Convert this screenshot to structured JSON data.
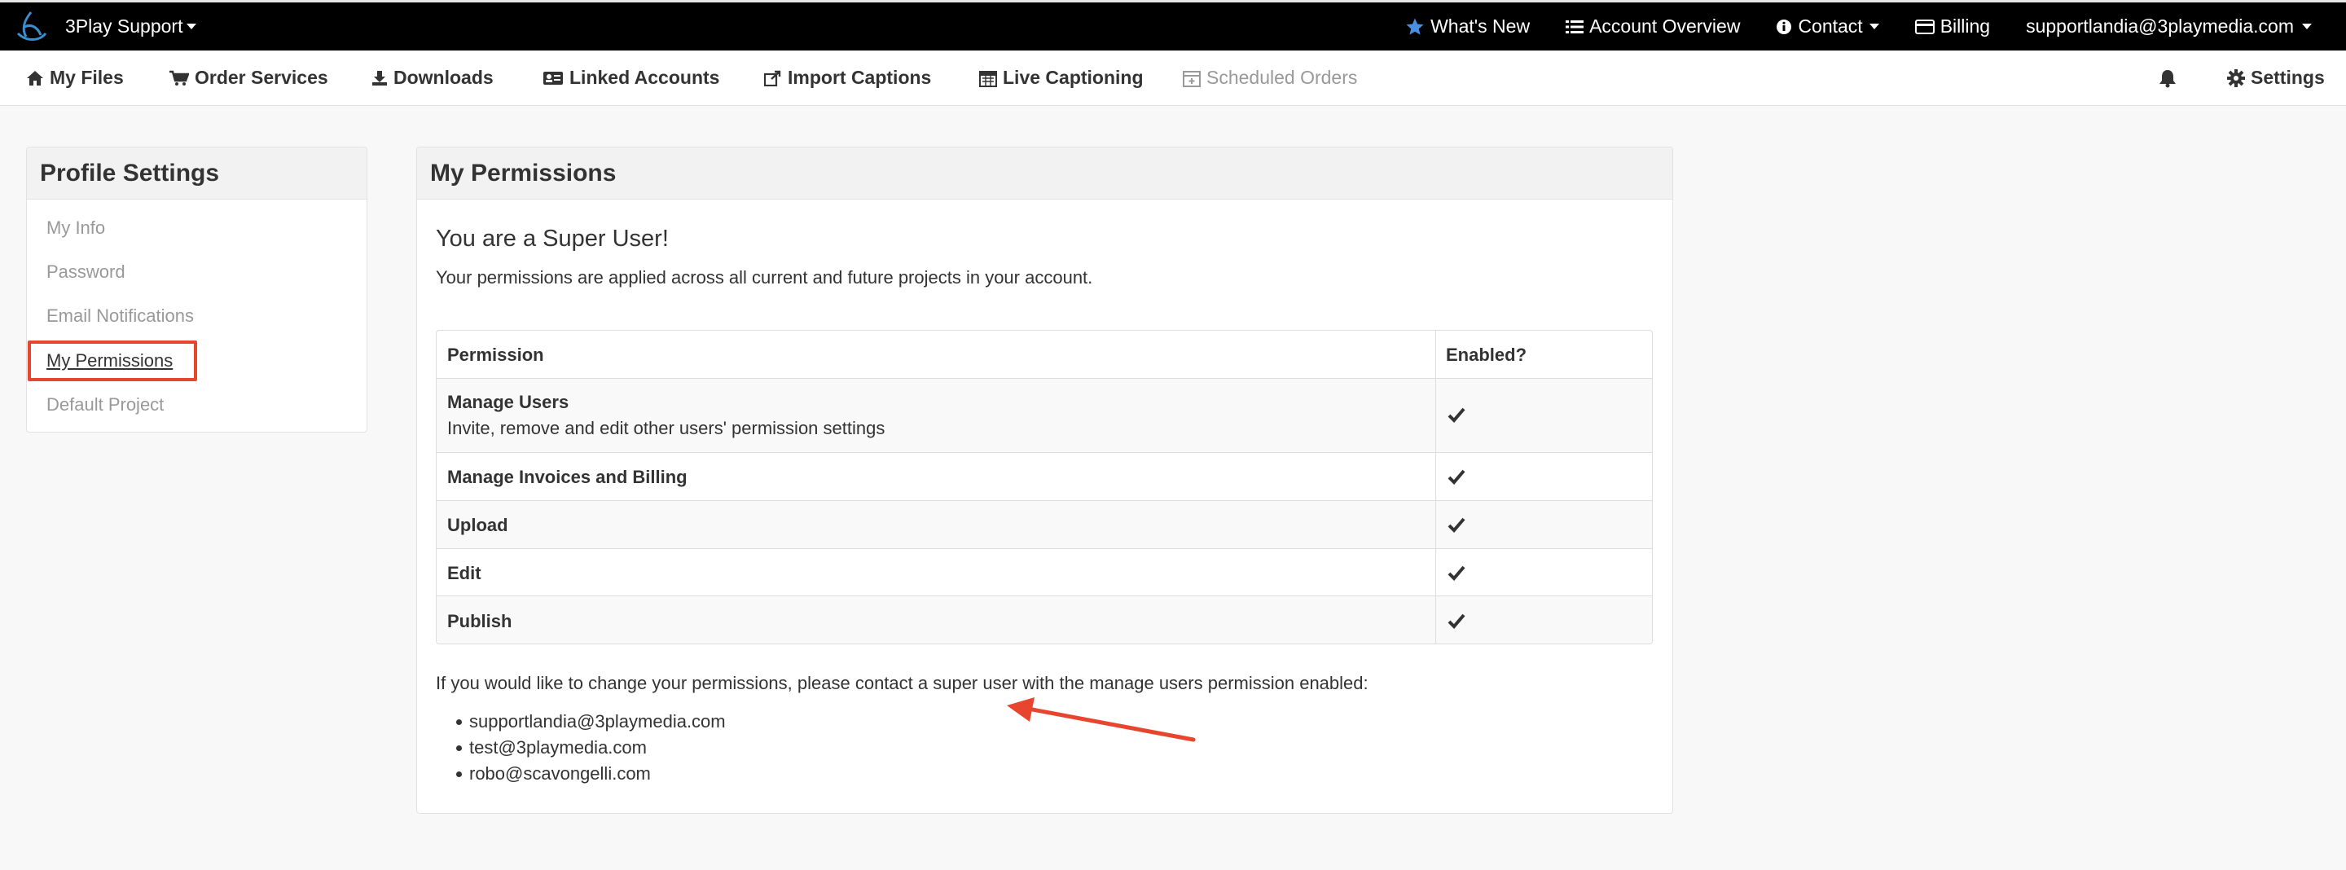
{
  "topbar": {
    "brand": "3Play Support",
    "whats_new": "What's New",
    "account_overview": "Account Overview",
    "contact": "Contact",
    "billing": "Billing",
    "user_email": "supportlandia@3playmedia.com"
  },
  "nav": {
    "my_files": "My Files",
    "order_services": "Order Services",
    "downloads": "Downloads",
    "linked_accounts": "Linked Accounts",
    "import_captions": "Import Captions",
    "live_captioning": "Live Captioning",
    "scheduled_orders": "Scheduled Orders",
    "settings": "Settings"
  },
  "sidebar": {
    "title": "Profile Settings",
    "items": [
      "My Info",
      "Password",
      "Email Notifications",
      "My Permissions",
      "Default Project"
    ]
  },
  "main": {
    "title": "My Permissions",
    "subtitle": "You are a Super User!",
    "description": "Your permissions are applied across all current and future projects in your account.",
    "table": {
      "col_permission": "Permission",
      "col_enabled": "Enabled?",
      "rows": [
        {
          "name": "Manage Users",
          "desc": "Invite, remove and edit other users' permission settings"
        },
        {
          "name": "Manage Invoices and Billing"
        },
        {
          "name": "Upload"
        },
        {
          "name": "Edit"
        },
        {
          "name": "Publish"
        }
      ]
    },
    "contact_text": "If you would like to change your permissions, please contact a super user with the manage users permission enabled:",
    "contacts": [
      "supportlandia@3playmedia.com",
      "test@3playmedia.com",
      "robo@scavongelli.com"
    ]
  },
  "colors": {
    "accent_red": "#e8452f",
    "star_blue": "#4a90e2"
  }
}
